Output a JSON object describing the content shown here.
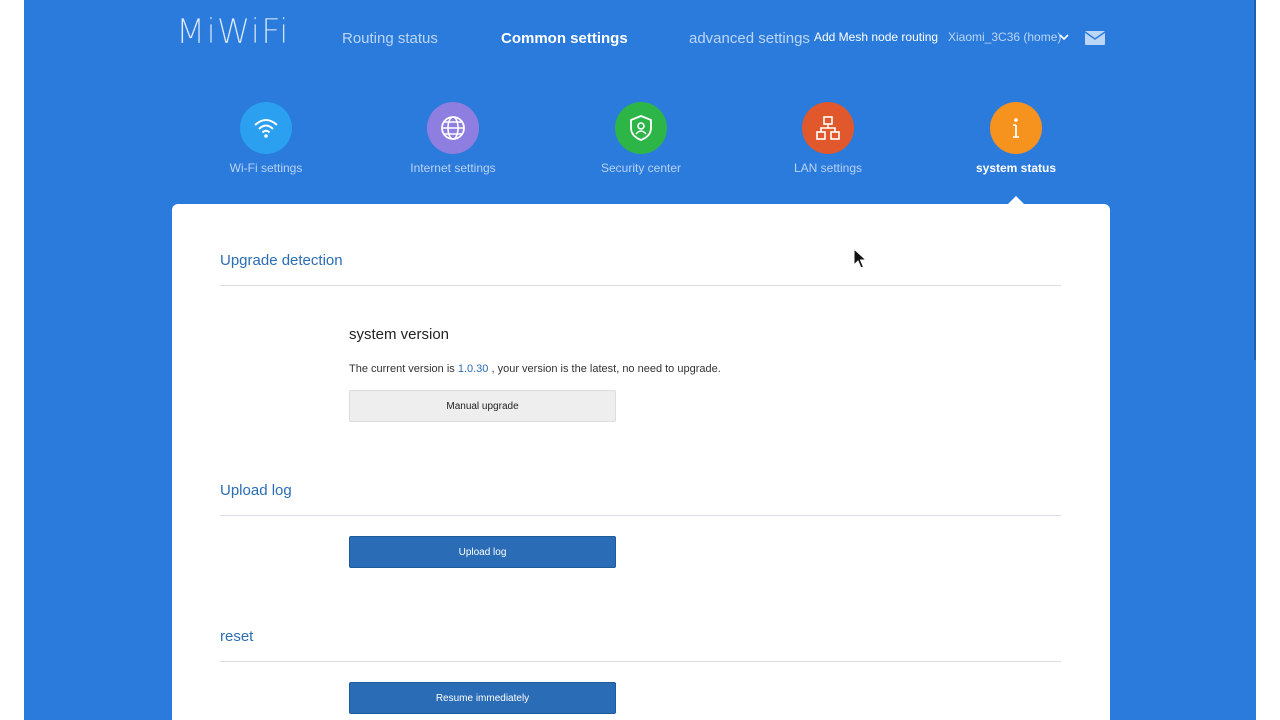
{
  "header": {
    "logo": "MiWiFi",
    "nav": {
      "routing_status": "Routing status",
      "common_settings": "Common settings",
      "advanced_settings": "advanced settings",
      "add_mesh": "Add Mesh node routing"
    },
    "device_name": "Xiaomi_3C36 (home)"
  },
  "categories": [
    {
      "label": "Wi-Fi settings",
      "icon": "wifi-icon",
      "color": "#2b9ff0"
    },
    {
      "label": "Internet settings",
      "icon": "globe-icon",
      "color": "#8e7ee0"
    },
    {
      "label": "Security center",
      "icon": "shield-icon",
      "color": "#2db548"
    },
    {
      "label": "LAN settings",
      "icon": "network-icon",
      "color": "#e0582c"
    },
    {
      "label": "system status",
      "icon": "info-icon",
      "color": "#f6921e"
    }
  ],
  "panel": {
    "upgrade": {
      "title": "Upgrade detection",
      "subtitle": "system version",
      "text_before": "The current version is ",
      "version": "1.0.30",
      "text_after": " , your version is the latest, no need to upgrade.",
      "button": "Manual upgrade"
    },
    "upload": {
      "title": "Upload log",
      "button": "Upload log"
    },
    "reset": {
      "title": "reset",
      "button": "Resume immediately"
    }
  },
  "colors": {
    "background": "#2b7bdc",
    "accent": "#2a6cb5"
  }
}
